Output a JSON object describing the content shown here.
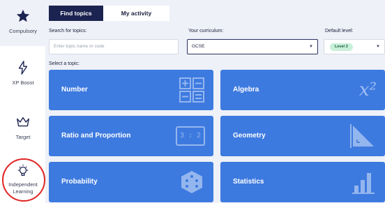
{
  "sidebar": {
    "items": [
      {
        "label": "Compulsory",
        "icon": "star-icon"
      },
      {
        "label": "XP Boost",
        "icon": "lightning-icon"
      },
      {
        "label": "Target",
        "icon": "crown-icon"
      },
      {
        "label": "Independent Learning",
        "icon": "lightbulb-icon"
      }
    ]
  },
  "tabs": [
    {
      "label": "Find topics",
      "active": true
    },
    {
      "label": "My activity",
      "active": false
    }
  ],
  "search": {
    "label": "Search for topics:",
    "placeholder": "Enter topic name or code"
  },
  "curriculum": {
    "label": "Your curriculum:",
    "value": "GCSE"
  },
  "level": {
    "label": "Default level:",
    "value": "Level 3"
  },
  "select_topic_label": "Select a topic:",
  "topics": [
    {
      "title": "Number",
      "icon": "calculator-icon"
    },
    {
      "title": "Algebra",
      "icon": "x-squared-icon",
      "icon_text": "x²"
    },
    {
      "title": "Ratio and Proportion",
      "icon": "ratio-icon",
      "icon_text": "3 : 2"
    },
    {
      "title": "Geometry",
      "icon": "triangle-ruler-icon"
    },
    {
      "title": "Probability",
      "icon": "dice-icon"
    },
    {
      "title": "Statistics",
      "icon": "bar-chart-icon"
    }
  ],
  "colors": {
    "navy": "#1b2350",
    "card_blue": "#3d7ae0",
    "background": "#eef1f7",
    "level_pill": "#c8efd9",
    "highlight_circle": "#e02424"
  }
}
